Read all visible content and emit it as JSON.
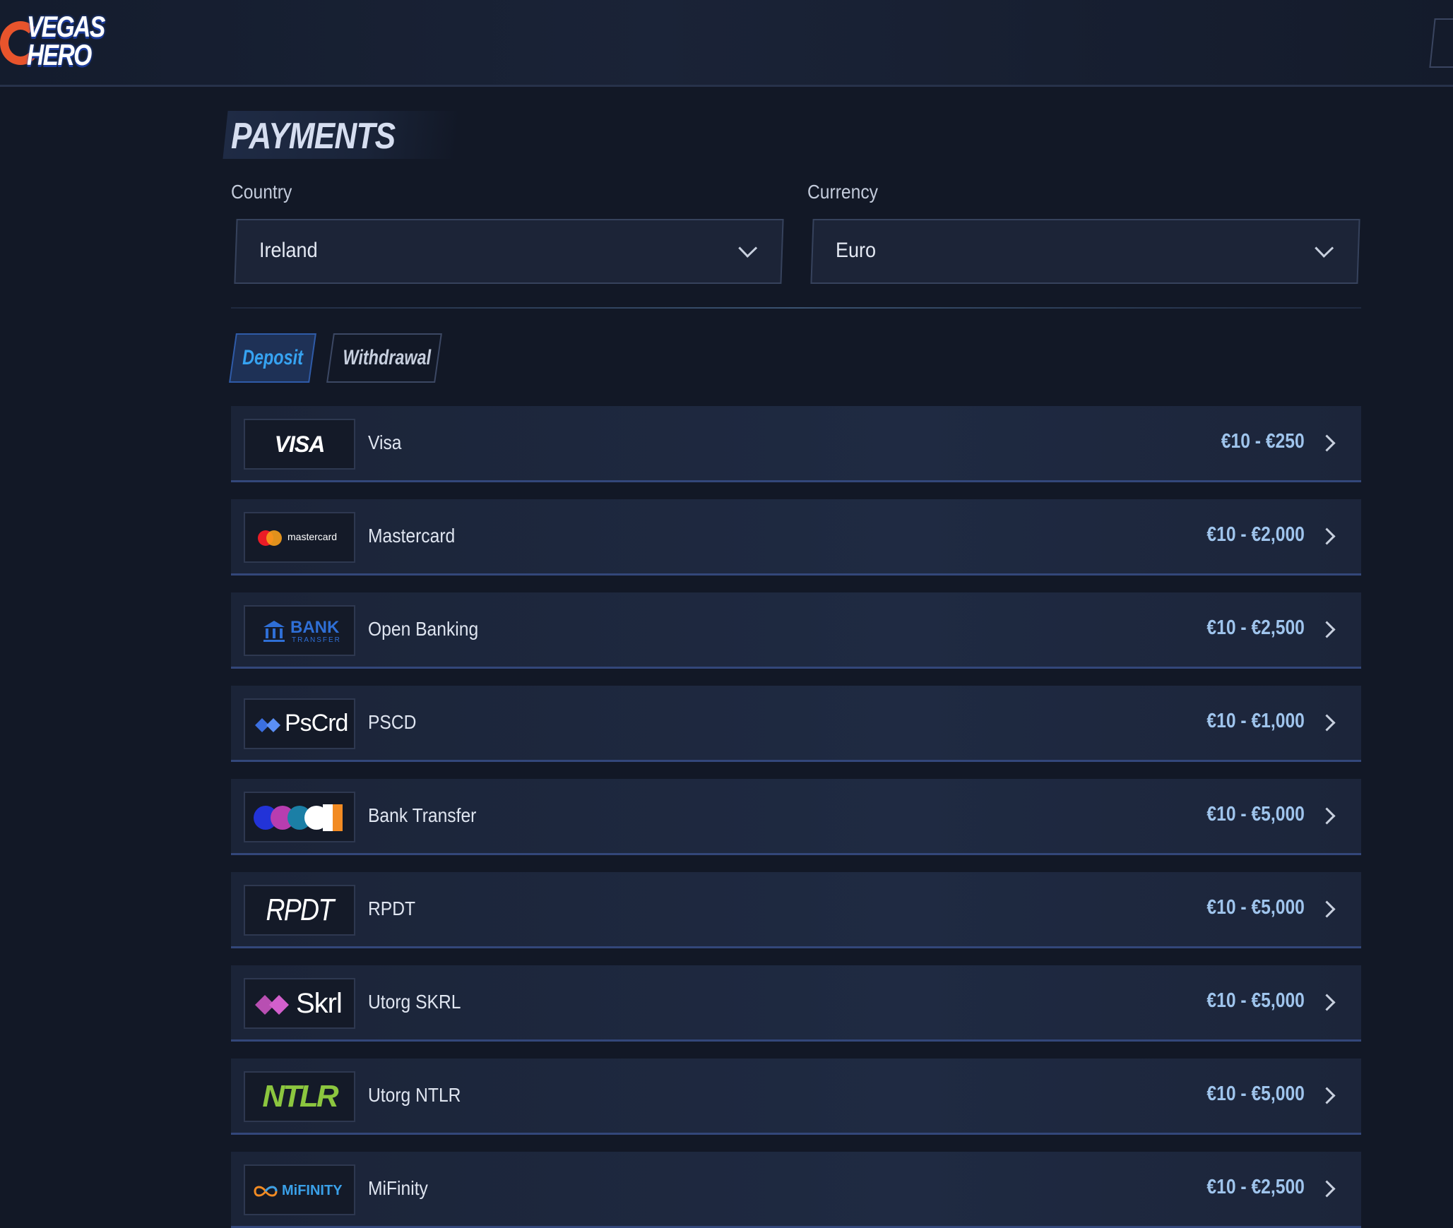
{
  "header": {
    "logo_line1": "VEGAS",
    "logo_line2": "HERO"
  },
  "page": {
    "title": "PAYMENTS"
  },
  "filters": {
    "country_label": "Country",
    "country_value": "Ireland",
    "currency_label": "Currency",
    "currency_value": "Euro"
  },
  "tabs": [
    {
      "label": "Deposit",
      "active": true
    },
    {
      "label": "Withdrawal",
      "active": false
    }
  ],
  "methods": [
    {
      "name": "Visa",
      "range": "€10 - €250",
      "logo_text": "VISA",
      "icon": "visa-logo-icon"
    },
    {
      "name": "Mastercard",
      "range": "€10 - €2,000",
      "logo_text": "mastercard",
      "icon": "mastercard-logo-icon"
    },
    {
      "name": "Open Banking",
      "range": "€10 - €2,500",
      "logo_text": "BANK",
      "logo_subtext": "TRANSFER",
      "icon": "bank-transfer-logo-icon"
    },
    {
      "name": "PSCD",
      "range": "€10 - €1,000",
      "logo_text": "PsCrd",
      "icon": "pscrd-logo-icon"
    },
    {
      "name": "Bank Transfer",
      "range": "€10 - €5,000",
      "icon": "bank-transfer-multi-logo-icon"
    },
    {
      "name": "RPDT",
      "range": "€10 - €5,000",
      "logo_text": "RPDT",
      "icon": "rpdt-logo-icon"
    },
    {
      "name": "Utorg SKRL",
      "range": "€10 - €5,000",
      "logo_text": "Skrl",
      "icon": "skrl-logo-icon"
    },
    {
      "name": "Utorg NTLR",
      "range": "€10 - €5,000",
      "logo_text": "NTLR",
      "icon": "ntlr-logo-icon"
    },
    {
      "name": "MiFinity",
      "range": "€10 - €2,500",
      "logo_text": "MiFINITY",
      "icon": "mifinity-logo-icon"
    }
  ],
  "colors": {
    "background": "#121826",
    "accent": "#36a3f2",
    "range_text": "#9fc4ec",
    "row_border": "#33477a"
  }
}
